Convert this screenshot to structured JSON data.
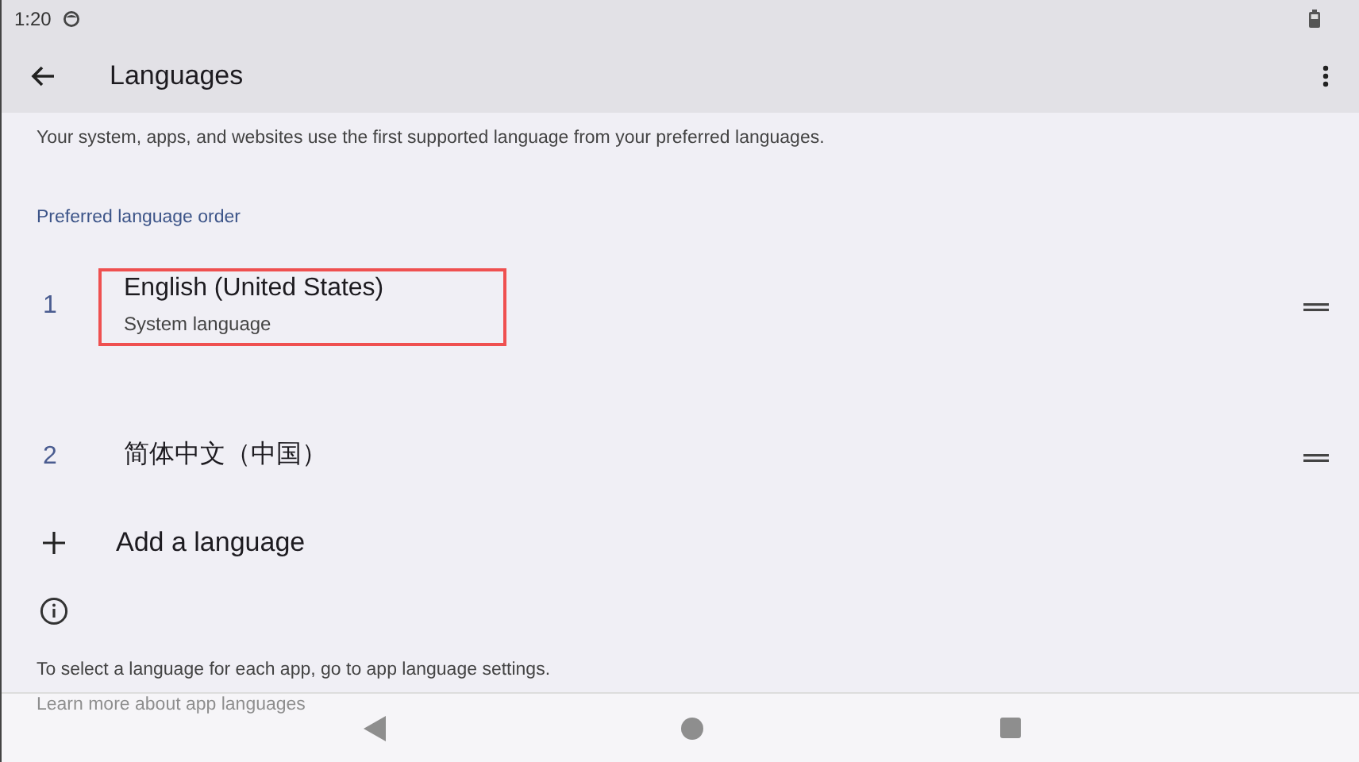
{
  "status_bar": {
    "time": "1:20"
  },
  "app_bar": {
    "title": "Languages"
  },
  "description": "Your system, apps, and websites use the first supported language from your preferred languages.",
  "section_title": "Preferred language order",
  "languages": [
    {
      "number": "1",
      "name": "English (United States)",
      "subtitle": "System language",
      "highlighted": true
    },
    {
      "number": "2",
      "name": "简体中文（中国）",
      "highlighted": false
    }
  ],
  "add_language": "Add a language",
  "footer_text": "To select a language for each app, go to app language settings.",
  "footer_link": "Learn more about app languages"
}
